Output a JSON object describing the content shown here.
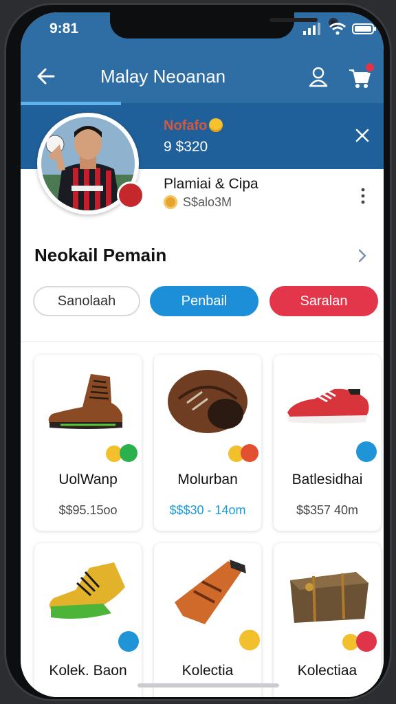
{
  "status": {
    "time": "9:81"
  },
  "header": {
    "title": "Malay Neoanan",
    "back_icon": "back-arrow-icon",
    "user_icon": "user-icon",
    "cart_icon": "cart-icon"
  },
  "profile": {
    "name": "Nofafo",
    "number": "9 $320",
    "subtitle": "Plamiai & Cipa",
    "meta": "S$alo3M"
  },
  "section": {
    "title": "Neokail Pemain"
  },
  "filters": [
    {
      "label": "Sanolaah",
      "active": false
    },
    {
      "label": "Penbail",
      "active": true
    },
    {
      "label": "Saralan",
      "active": true
    }
  ],
  "products": [
    {
      "name": "UolWanp",
      "price": "$$95.15oo"
    },
    {
      "name": "Molurban",
      "price": "$$$30 - 14om",
      "price_color": "#1b9ad8"
    },
    {
      "name": "Batlesidhai",
      "price": "$$357 40m"
    },
    {
      "name": "Kolek. Baon",
      "price": ""
    },
    {
      "name": "Kolectia",
      "price": ""
    },
    {
      "name": "Kolectiaa",
      "price": ""
    }
  ],
  "colors": {
    "header": "#2f6ea5",
    "band": "#20609a",
    "accent_blue": "#1d8fd8",
    "accent_red": "#e3364b"
  }
}
